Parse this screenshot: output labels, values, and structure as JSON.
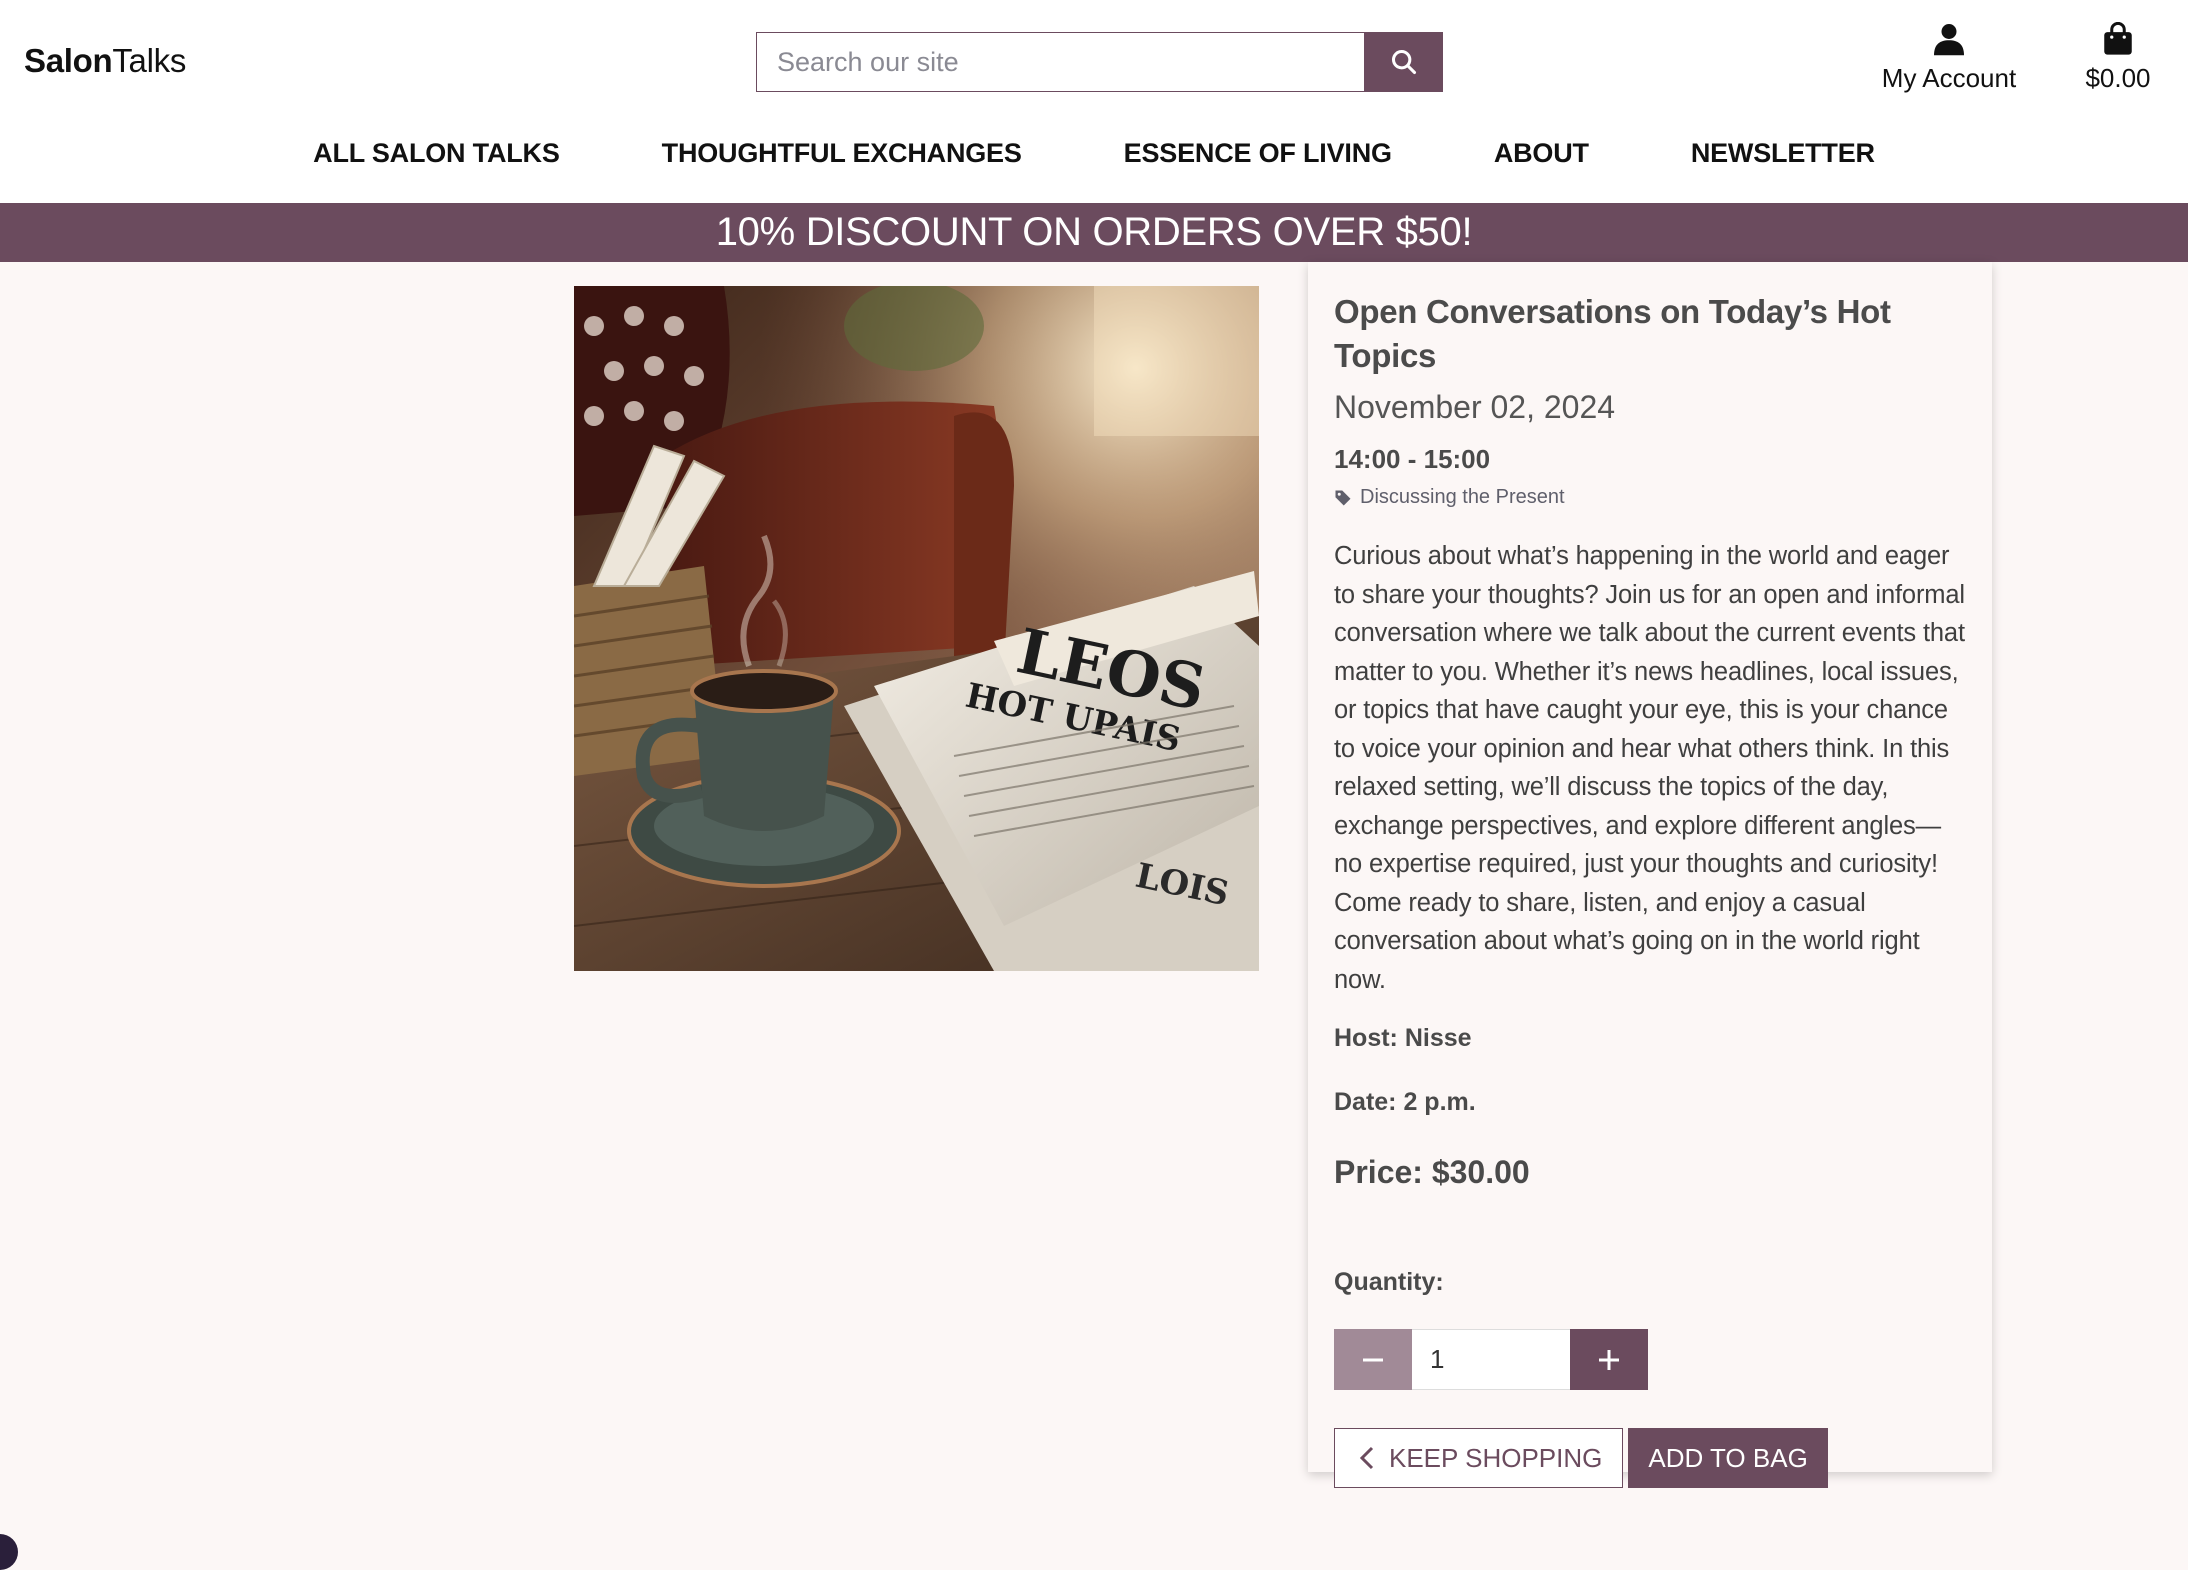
{
  "brand": {
    "bold": "Salon",
    "light": "Talks"
  },
  "search": {
    "placeholder": "Search our site",
    "value": ""
  },
  "header": {
    "account_label": "My Account",
    "bag_total": "$0.00"
  },
  "nav": {
    "items": [
      {
        "label": "ALL SALON TALKS"
      },
      {
        "label": "THOUGHTFUL EXCHANGES"
      },
      {
        "label": "ESSENCE OF LIVING"
      },
      {
        "label": "ABOUT"
      },
      {
        "label": "NEWSLETTER"
      }
    ]
  },
  "promo": {
    "text": "10% DISCOUNT ON ORDERS OVER $50!"
  },
  "product": {
    "title": "Open Conversations on Today’s Hot Topics",
    "date": "November 02, 2024",
    "time": "14:00 - 15:00",
    "category": "Discussing the Present",
    "description": "Curious about what’s happening in the world and eager to share your thoughts? Join us for an open and informal conversation where we talk about the current events that matter to you. Whether it’s news headlines, local issues, or topics that have caught your eye, this is your chance to voice your opinion and hear what others think. In this relaxed setting, we’ll discuss the topics of the day, exchange perspectives, and explore different angles—no expertise required, just your thoughts and curiosity! Come ready to share, listen, and enjoy a casual conversation about what’s going on in the world right now.",
    "host": "Host: Nisse",
    "date_line": "Date: 2 p.m.",
    "price": "Price: $30.00",
    "image_newspaper_headline": "LEOS",
    "image_newspaper_subhead": "HOT UPAIS",
    "image_newspaper_lower": "LOIS"
  },
  "quantity": {
    "label": "Quantity:",
    "value": "1"
  },
  "actions": {
    "keep_shopping": "KEEP SHOPPING",
    "add_to_bag": "ADD TO BAG"
  },
  "colors": {
    "accent": "#6b4b5e",
    "accent_light": "#a18a97",
    "page_bg": "#fcf7f6"
  }
}
